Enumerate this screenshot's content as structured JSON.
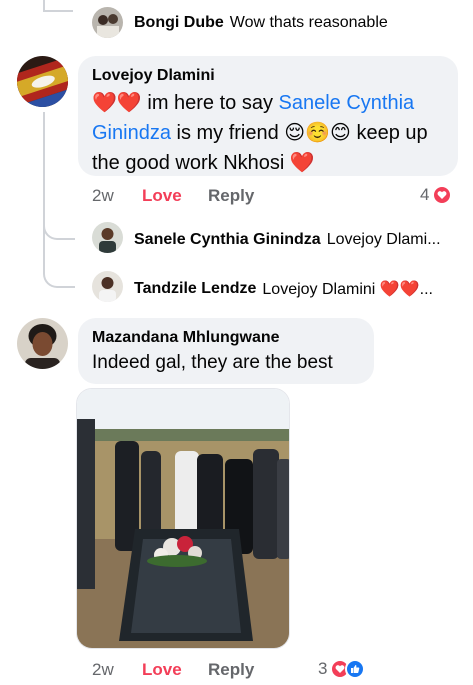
{
  "replies_top": {
    "name": "Bongi Dube",
    "text": "Wow thats reasonable"
  },
  "comment1": {
    "author": "Lovejoy Dlamini",
    "hearts_prefix": "❤️❤️",
    "text_before": " im here to say ",
    "mention": "Sanele Cynthia Ginindza",
    "text_after": " is my friend 😌☺️😊 keep up the good work Nkhosi ❤️",
    "time": "2w",
    "love_label": "Love",
    "reply_label": "Reply",
    "reaction_count": "4",
    "replies": [
      {
        "name": "Sanele Cynthia Ginindza",
        "snippet": "Lovejoy Dlami..."
      },
      {
        "name": "Tandzile Lendze",
        "snippet": "Lovejoy Dlamini ❤️❤️..."
      }
    ]
  },
  "comment2": {
    "author": "Mazandana Mhlungwane",
    "text": "Indeed gal, they are the best",
    "time": "2w",
    "love_label": "Love",
    "reply_label": "Reply",
    "reaction_count": "3"
  },
  "colors": {
    "accent_love": "#f33e58",
    "mention_blue": "#1877f2",
    "bubble_bg": "#f0f2f5",
    "muted_text": "#65676b"
  }
}
